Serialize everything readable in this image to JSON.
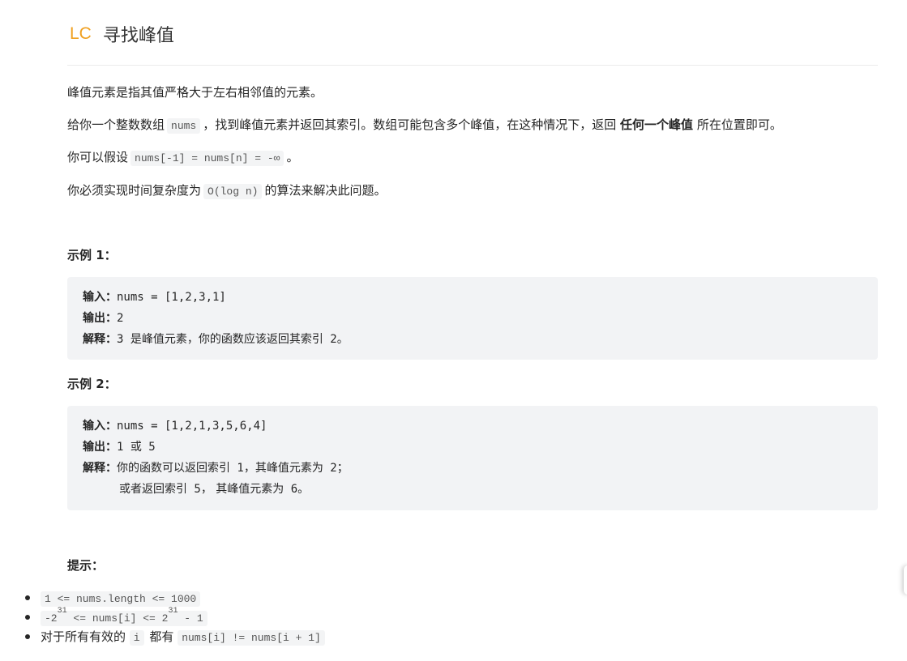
{
  "header": {
    "logo": "LC",
    "title": "寻找峰值"
  },
  "description": {
    "p1": "峰值元素是指其值严格大于左右相邻值的元素。",
    "p2_a": "给你一个整数数组",
    "p2_code": "nums",
    "p2_b": "，找到峰值元素并返回其索引。数组可能包含多个峰值，在这种情况下，返回",
    "p2_strong": "任何一个峰值",
    "p2_c": "所在位置即可。",
    "p3_a": "你可以假设",
    "p3_code": "nums[-1] = nums[n] = -∞",
    "p3_b": "。",
    "p4_a": "你必须实现时间复杂度为",
    "p4_code": "O(log n)",
    "p4_b": "的算法来解决此问题。"
  },
  "example1": {
    "title": "示例 1：",
    "input_label": "输入：",
    "input_value": "nums = [1,2,3,1]",
    "output_label": "输出：",
    "output_value": "2",
    "explain_label": "解释：",
    "explain_num": "3 ",
    "explain_text": "是峰值元素，你的函数应该返回其索引",
    "explain_idx": " 2",
    "explain_end": "。"
  },
  "example2": {
    "title": "示例 2：",
    "input_label": "输入：",
    "input_value": "nums = [1,2,1,3,5,6,4]",
    "output_label": "输出：",
    "output_a": "1 ",
    "output_or": "或",
    "output_b": " 5",
    "explain_label": "解释：",
    "explain_a": "你的函数可以返回索引",
    "explain_a_num": " 1",
    "explain_b": "，其峰值元素为",
    "explain_b_num": " 2",
    "explain_b_end": "；",
    "explain2_a": "或者返回索引",
    "explain2_num": " 5",
    "explain2_b": "， 其峰值元素为",
    "explain2_num2": " 6",
    "explain2_end": "。"
  },
  "hints": {
    "title": "提示：",
    "h1_code": "1 <= nums.length <= 1000",
    "h2_a": "-2",
    "h2_exp1": "31",
    "h2_b": " <= nums[i] <= 2",
    "h2_exp2": "31",
    "h2_c": " - 1",
    "h3_a": "对于所有有效的",
    "h3_code1": "i",
    "h3_b": "都有",
    "h3_code2": "nums[i] != nums[i + 1]"
  }
}
